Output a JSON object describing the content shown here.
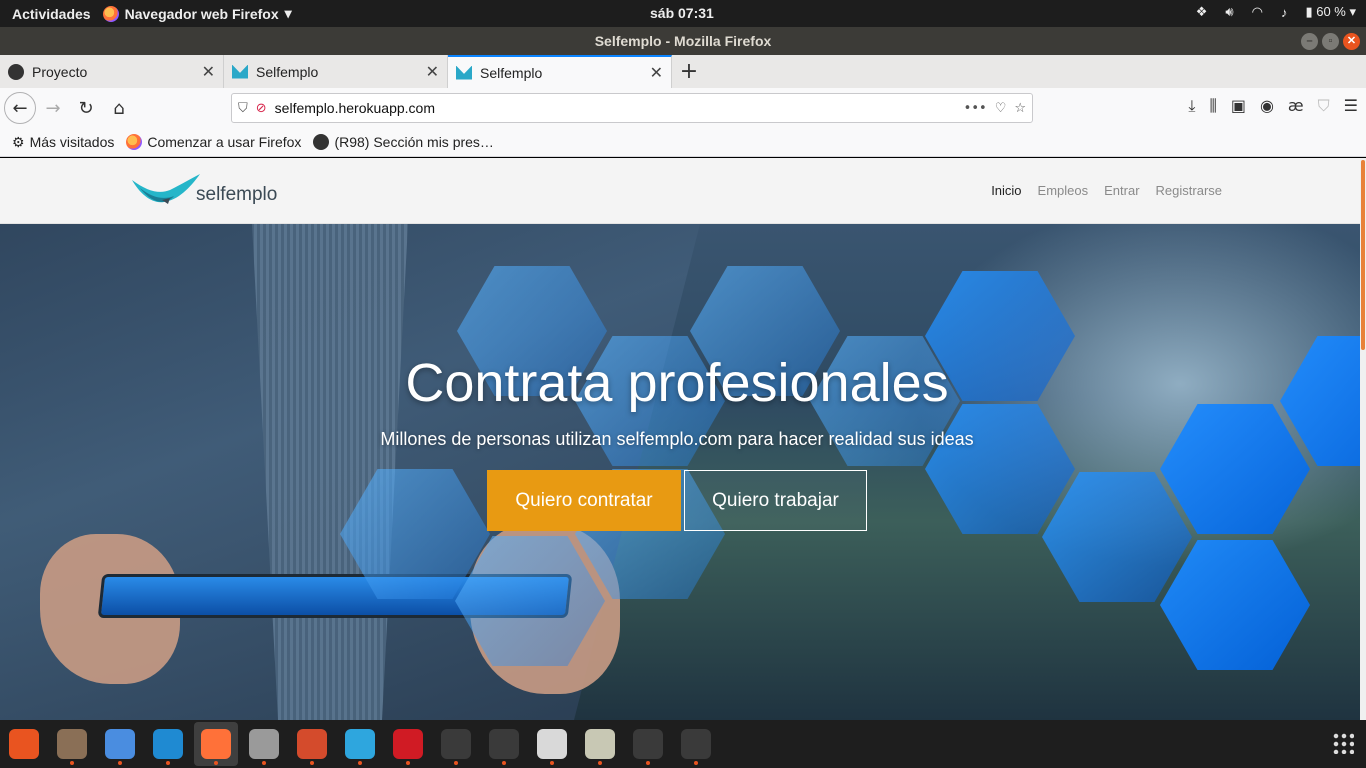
{
  "system": {
    "activities": "Actividades",
    "app_name": "Navegador web Firefox",
    "clock": "sáb 07:31",
    "battery": "60 %"
  },
  "window": {
    "title": "Selfemplo - Mozilla Firefox"
  },
  "tabs": [
    {
      "label": "Proyecto",
      "icon": "github-icon"
    },
    {
      "label": "Selfemplo",
      "icon": "selfemplo-icon"
    },
    {
      "label": "Selfemplo",
      "icon": "selfemplo-icon",
      "active": true
    }
  ],
  "urlbar": {
    "url": "selfemplo.herokuapp.com"
  },
  "bookmarks": [
    {
      "label": "Más visitados",
      "icon": "gear-icon"
    },
    {
      "label": "Comenzar a usar Firefox",
      "icon": "firefox-icon"
    },
    {
      "label": "(R98) Sección mis pres…",
      "icon": "github-icon"
    }
  ],
  "site": {
    "logo_text": "selfemplo",
    "menu": [
      {
        "label": "Inicio",
        "active": true
      },
      {
        "label": "Empleos"
      },
      {
        "label": "Entrar"
      },
      {
        "label": "Registrarse"
      }
    ],
    "hero": {
      "title": "Contrata profesionales",
      "subtitle": "Millones de personas utilizan selfemplo.com para hacer realidad sus ideas",
      "primary_cta": "Quiero contratar",
      "secondary_cta": "Quiero trabajar"
    }
  },
  "colors": {
    "cta_orange": "#e89a12",
    "firefox_tab_accent": "#0a84ff",
    "ubuntu_orange": "#e95420"
  },
  "dock": [
    {
      "name": "software-center-icon",
      "color": "#e95420"
    },
    {
      "name": "files-icon",
      "color": "#8a6f56"
    },
    {
      "name": "chromium-icon",
      "color": "#4a8de0"
    },
    {
      "name": "vscode-icon",
      "color": "#1f8ad2"
    },
    {
      "name": "firefox-icon",
      "color": "#ff7139",
      "active": true
    },
    {
      "name": "camera-icon",
      "color": "#9a9a9a"
    },
    {
      "name": "settings-tool-icon",
      "color": "#d44b2c"
    },
    {
      "name": "telegram-icon",
      "color": "#2ea6de"
    },
    {
      "name": "opera-icon",
      "color": "#d01b24"
    },
    {
      "name": "terminal-icon",
      "color": "#3a3a3a"
    },
    {
      "name": "terminal-icon",
      "color": "#3a3a3a"
    },
    {
      "name": "text-editor-icon",
      "color": "#d9d9d9"
    },
    {
      "name": "image-viewer-icon",
      "color": "#c8c8b4"
    },
    {
      "name": "terminal-icon",
      "color": "#3a3a3a"
    },
    {
      "name": "terminal-icon",
      "color": "#3a3a3a"
    }
  ]
}
